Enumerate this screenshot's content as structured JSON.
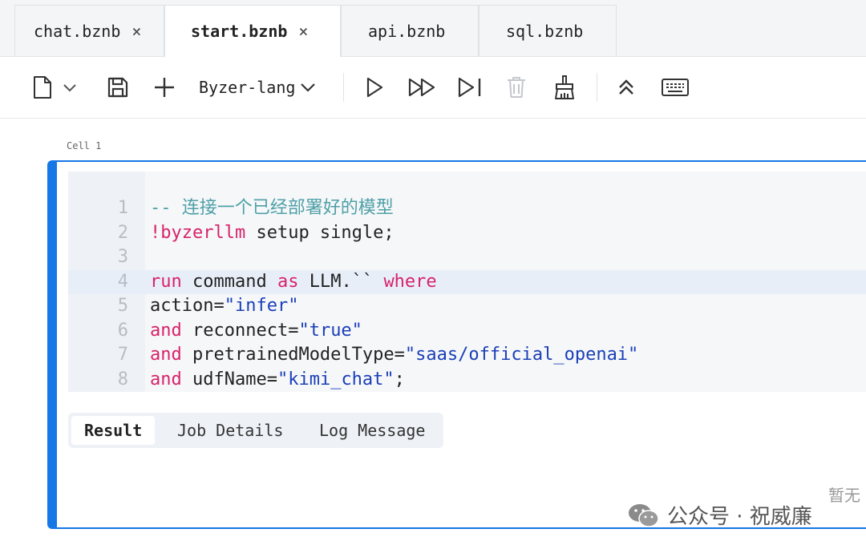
{
  "tabs": [
    {
      "label": "chat.bznb",
      "close": "×",
      "active": false
    },
    {
      "label": "start.bznb",
      "close": "×",
      "active": true
    },
    {
      "label": "api.bznb"
    },
    {
      "label": "sql.bznb"
    }
  ],
  "toolbar": {
    "language": "Byzer-lang",
    "icons": [
      "new-file-icon",
      "chevron-down-icon",
      "save-icon",
      "add-icon",
      "run-icon",
      "run-all-icon",
      "run-to-end-icon",
      "delete-icon",
      "clear-icon",
      "collapse-icon",
      "keyboard-icon"
    ]
  },
  "cell": {
    "label": "Cell 1",
    "lines": [
      {
        "n": "1",
        "tokens": [
          {
            "t": "-- 连接一个已经部署好的模型",
            "c": "cm"
          }
        ]
      },
      {
        "n": "2",
        "tokens": [
          {
            "t": "!byzerllm",
            "c": "kw"
          },
          {
            "t": " setup single;",
            "c": "pl"
          }
        ]
      },
      {
        "n": "3",
        "tokens": []
      },
      {
        "n": "4",
        "tokens": [
          {
            "t": "run",
            "c": "kw"
          },
          {
            "t": " command ",
            "c": "pl"
          },
          {
            "t": "as",
            "c": "kw"
          },
          {
            "t": " LLM.`` ",
            "c": "pl"
          },
          {
            "t": "where",
            "c": "kw"
          }
        ]
      },
      {
        "n": "5",
        "tokens": [
          {
            "t": "action=",
            "c": "pl"
          },
          {
            "t": "\"infer\"",
            "c": "str"
          }
        ]
      },
      {
        "n": "6",
        "tokens": [
          {
            "t": "and",
            "c": "kw"
          },
          {
            "t": " reconnect=",
            "c": "pl"
          },
          {
            "t": "\"true\"",
            "c": "str"
          }
        ]
      },
      {
        "n": "7",
        "tokens": [
          {
            "t": "and",
            "c": "kw"
          },
          {
            "t": " pretrainedModelType=",
            "c": "pl"
          },
          {
            "t": "\"saas/official_openai\"",
            "c": "str"
          }
        ]
      },
      {
        "n": "8",
        "tokens": [
          {
            "t": "and",
            "c": "kw"
          },
          {
            "t": " udfName=",
            "c": "pl"
          },
          {
            "t": "\"kimi_chat\"",
            "c": "str"
          },
          {
            "t": ";",
            "c": "pl"
          }
        ]
      }
    ]
  },
  "result_tabs": [
    "Result",
    "Job Details",
    "Log Message"
  ],
  "watermark": {
    "text": "公众号 · 祝威廉",
    "side": "暂无"
  },
  "colors": {
    "accent": "#1677e6",
    "keyword": "#d7236a",
    "comment": "#4ea0a7",
    "string": "#1a3fb8"
  }
}
